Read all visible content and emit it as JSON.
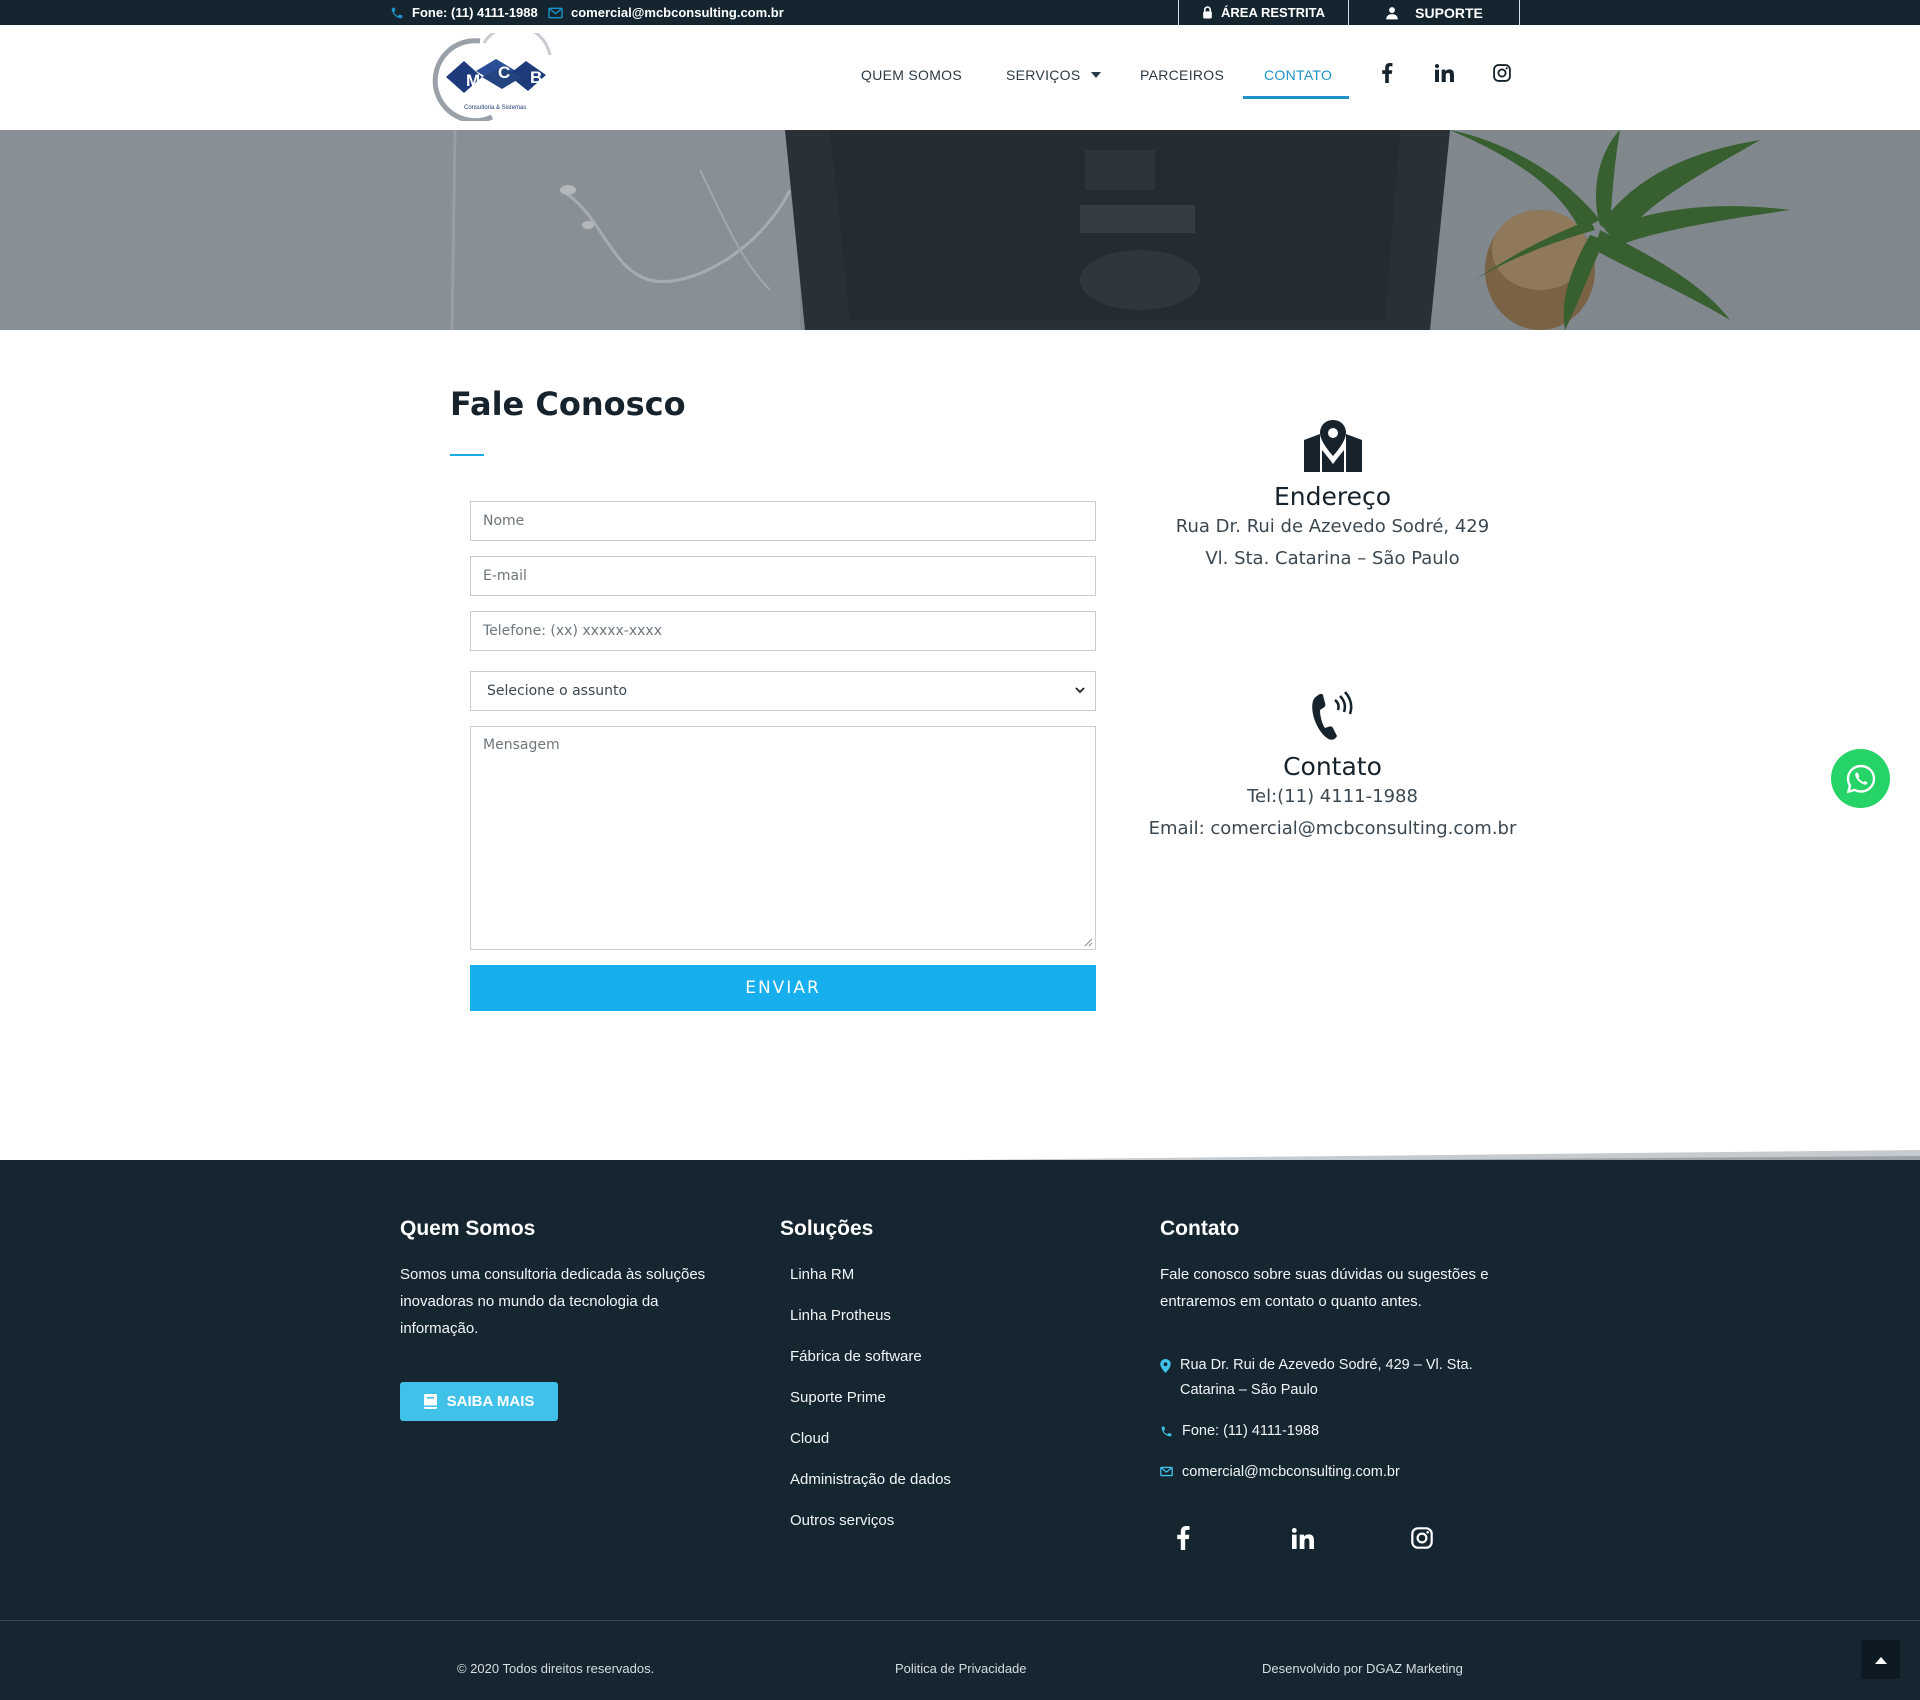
{
  "topbar": {
    "phone": "Fone: (11) 4111-1988",
    "email": "comercial@mcbconsulting.com.br",
    "restricted_label": "ÁREA RESTRITA",
    "support_label": "SUPORTE"
  },
  "logo": {
    "letters": [
      "M",
      "C",
      "B"
    ],
    "tagline": "Consultoria & Sistemas"
  },
  "nav": {
    "items": [
      {
        "label": "QUEM SOMOS"
      },
      {
        "label": "SERVIÇOS"
      },
      {
        "label": "PARCEIROS"
      },
      {
        "label": "CONTATO"
      }
    ],
    "active": "CONTATO",
    "social_icons": [
      "facebook-icon",
      "linkedin-icon",
      "instagram-icon"
    ]
  },
  "contact_form": {
    "title": "Fale Conosco",
    "name_placeholder": "Nome",
    "email_placeholder": "E-mail",
    "phone_placeholder": "Telefone: (xx) xxxxx-xxxx",
    "subject_selected": "Selecione o assunto",
    "message_placeholder": "Mensagem",
    "submit_label": "ENVIAR"
  },
  "info": {
    "address_title": "Endereço",
    "address_line1": "Rua Dr. Rui de Azevedo Sodré, 429",
    "address_line2": "Vl. Sta. Catarina – São Paulo",
    "contact_title": "Contato",
    "contact_phone": "Tel:(11) 4111-1988",
    "contact_email": "Email: comercial@mcbconsulting.com.br"
  },
  "footer": {
    "about_title": "Quem Somos",
    "about_text": "Somos uma consultoria dedicada às soluções inovadoras no mundo da tecnologia da informação.",
    "more_label": "SAIBA MAIS",
    "solutions_title": "Soluções",
    "solutions": [
      "Linha RM",
      "Linha Protheus",
      "Fábrica de software",
      "Suporte Prime",
      "Cloud",
      "Administração de dados",
      "Outros serviços"
    ],
    "contact_title": "Contato",
    "contact_text": "Fale conosco sobre suas dúvidas ou sugestões e entraremos em contato o quanto antes.",
    "address": "Rua Dr. Rui de Azevedo Sodré, 429 – Vl. Sta. Catarina – São Paulo",
    "phone": "Fone: (11) 4111-1988",
    "email": "comercial@mcbconsulting.com.br",
    "copyright": "© 2020 Todos direitos reservados.",
    "privacy": "Politica de Privacidade",
    "developer": "Desenvolvido por DGAZ Marketing"
  },
  "colors": {
    "dark": "#152630",
    "accent": "#1c93c6",
    "button": "#17aeee",
    "whatsapp": "#25d366"
  }
}
